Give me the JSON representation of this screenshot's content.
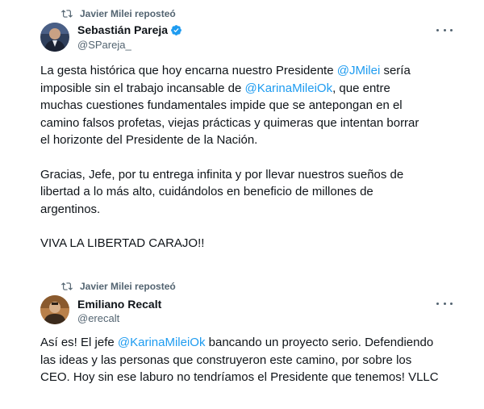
{
  "tweet1": {
    "repost_label": "Javier Milei reposteó",
    "author_name": "Sebastián Pareja",
    "author_handle": "@SPareja_",
    "verified": true,
    "paragraphs": [
      {
        "lines": [
          [
            {
              "t": "La gesta histórica que hoy encarna nuestro Presidente "
            },
            {
              "m": "@JMilei"
            },
            {
              "t": " sería"
            }
          ],
          [
            {
              "t": "imposible sin el trabajo incansable de "
            },
            {
              "m": "@KarinaMileiOk"
            },
            {
              "t": ", que entre"
            }
          ],
          [
            {
              "t": "muchas cuestiones fundamentales impide que se antepongan en el"
            }
          ],
          [
            {
              "t": "camino falsos profetas, viejas prácticas y quimeras que intentan borrar"
            }
          ],
          [
            {
              "t": "el horizonte del Presidente de la Nación."
            }
          ]
        ]
      },
      {
        "lines": [
          [
            {
              "t": "Gracias, Jefe, por tu entrega infinita y por llevar nuestros sueños de"
            }
          ],
          [
            {
              "t": "libertad a lo más alto, cuidándolos en beneficio de millones de"
            }
          ],
          [
            {
              "t": "argentinos."
            }
          ]
        ]
      },
      {
        "lines": [
          [
            {
              "t": "VIVA LA LIBERTAD CARAJO!!"
            }
          ]
        ]
      }
    ]
  },
  "tweet2": {
    "repost_label": "Javier Milei reposteó",
    "author_name": "Emiliano Recalt",
    "author_handle": "@erecalt",
    "verified": false,
    "paragraphs": [
      {
        "lines": [
          [
            {
              "t": "Así es! El jefe "
            },
            {
              "m": "@KarinaMileiOk"
            },
            {
              "t": " bancando un proyecto serio. Defendiendo"
            }
          ],
          [
            {
              "t": "las ideas y las personas que construyeron este camino, por sobre los"
            }
          ],
          [
            {
              "t": "CEO. Hoy sin ese laburo no tendríamos el Presidente que tenemos! VLLC"
            }
          ]
        ]
      }
    ]
  },
  "colors": {
    "link": "#1d9bf0",
    "secondary_text": "#536471",
    "primary_text": "#0f1419",
    "verified_badge": "#1d9bf0"
  },
  "icons": {
    "repost": "repost-icon",
    "verified": "verified-badge-icon",
    "more": "more-options-icon"
  }
}
